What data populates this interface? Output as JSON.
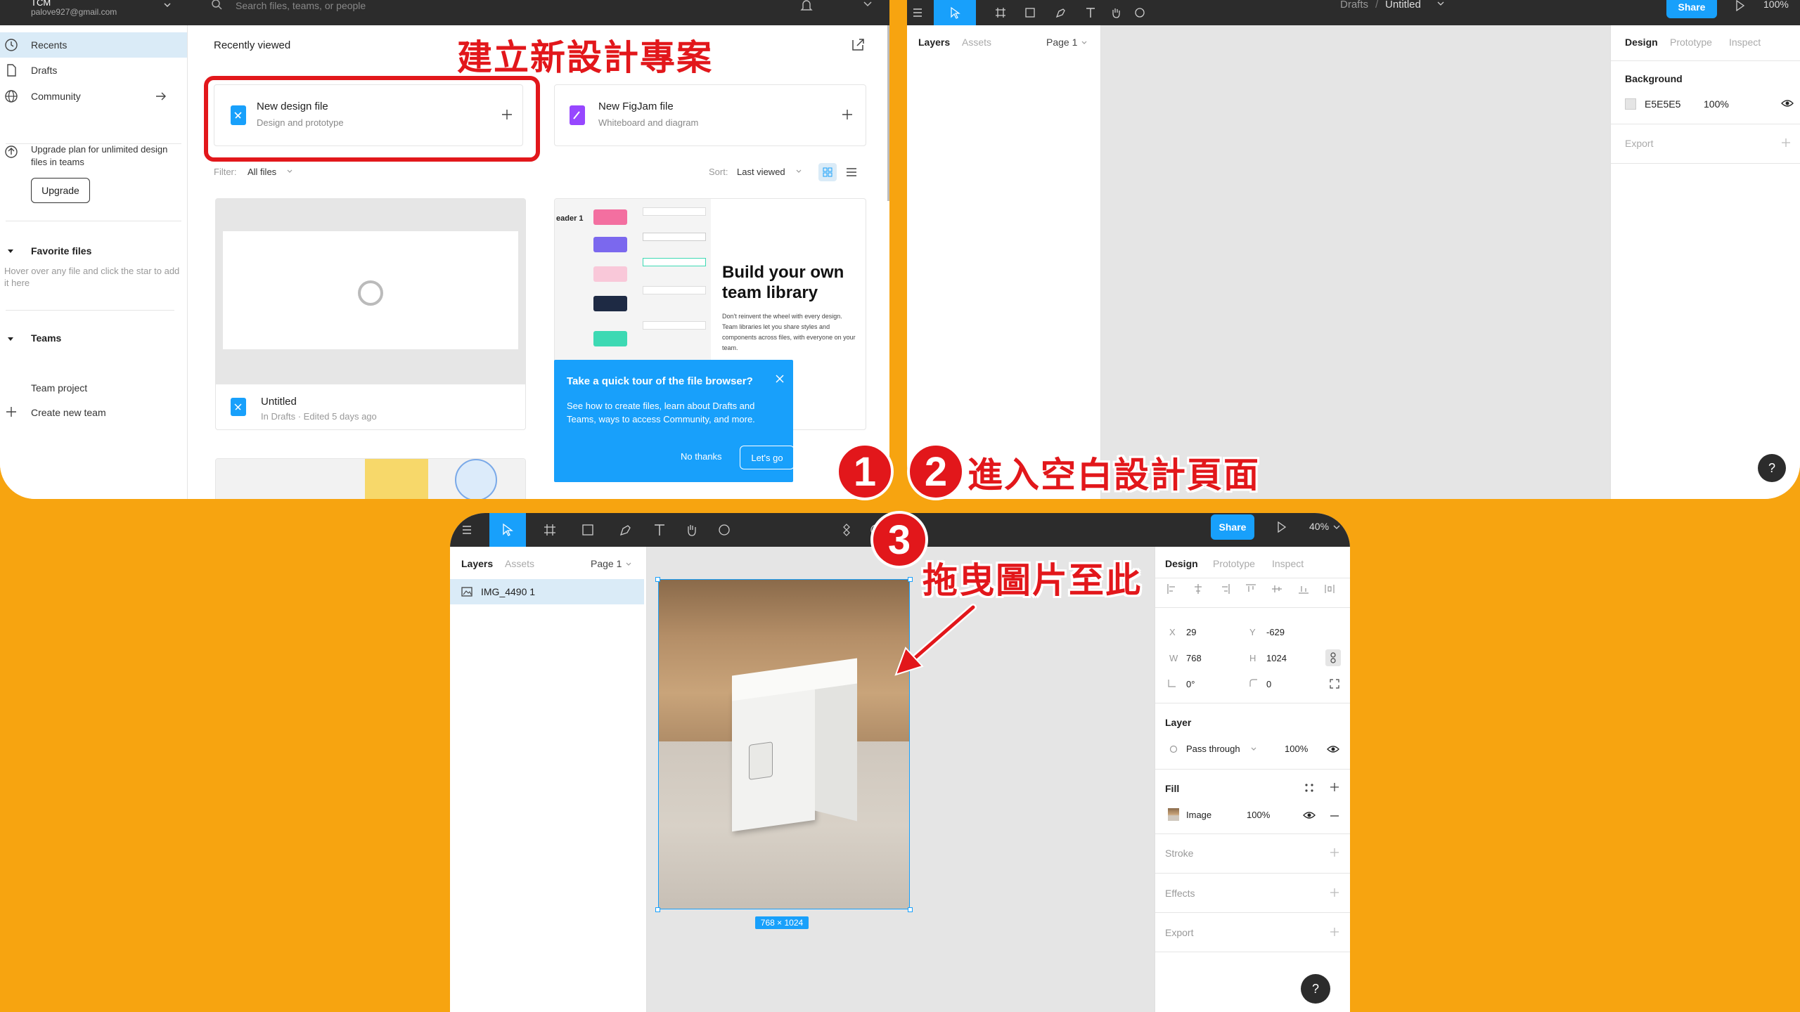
{
  "panel1": {
    "account": {
      "name": "TCM",
      "email": "palove927@gmail.com"
    },
    "search_placeholder": "Search files, teams, or people",
    "sidebar": {
      "recents": "Recents",
      "drafts": "Drafts",
      "community": "Community",
      "upgrade_text": "Upgrade plan for unlimited design files in teams",
      "upgrade_button": "Upgrade",
      "favorites_title": "Favorite files",
      "favorites_hint": "Hover over any file and click the star to add it here",
      "teams_title": "Teams",
      "team_project": "Team project",
      "create_team": "Create new team"
    },
    "main": {
      "heading": "Recently viewed",
      "new_design": {
        "title": "New design file",
        "subtitle": "Design and prototype"
      },
      "new_figjam": {
        "title": "New FigJam file",
        "subtitle": "Whiteboard and diagram"
      },
      "filter_label": "Filter:",
      "filter_value": "All files",
      "sort_label": "Sort:",
      "sort_value": "Last viewed",
      "file": {
        "name": "Untitled",
        "meta": "In Drafts · Edited 5 days ago"
      },
      "promo": {
        "title": "Build your own team library",
        "body": "Don't reinvent the wheel with every design. Team libraries let you share styles and components across files, with everyone on your team."
      },
      "tour": {
        "title": "Take a quick tour of the file browser?",
        "body": "See how to create files, learn about Drafts and Teams, ways to access Community, and more.",
        "no_thanks": "No thanks",
        "lets_go": "Let's go"
      }
    }
  },
  "panel2": {
    "breadcrumb_drafts": "Drafts",
    "breadcrumb_sep": "/",
    "file_title": "Untitled",
    "share": "Share",
    "zoom": "100%",
    "left_tabs": {
      "layers": "Layers",
      "assets": "Assets",
      "page": "Page 1"
    },
    "right_tabs": {
      "design": "Design",
      "prototype": "Prototype",
      "inspect": "Inspect"
    },
    "background_title": "Background",
    "background_hex": "E5E5E5",
    "background_opacity": "100%",
    "export": "Export",
    "help": "?"
  },
  "panel3": {
    "share": "Share",
    "zoom": "40%",
    "left_tabs": {
      "layers": "Layers",
      "assets": "Assets",
      "page": "Page 1"
    },
    "layer_name": "IMG_4490 1",
    "size_badge": "768 × 1024",
    "right_tabs": {
      "design": "Design",
      "prototype": "Prototype",
      "inspect": "Inspect"
    },
    "props": {
      "x_label": "X",
      "x": "29",
      "y_label": "Y",
      "y": "-629",
      "w_label": "W",
      "w": "768",
      "h_label": "H",
      "h": "1024",
      "rotation": "0°",
      "radius": "0"
    },
    "layer_title": "Layer",
    "blend": "Pass through",
    "layer_opacity": "100%",
    "fill_title": "Fill",
    "fill_type": "Image",
    "fill_opacity": "100%",
    "stroke": "Stroke",
    "effects": "Effects",
    "export": "Export",
    "help": "?"
  },
  "annotations": {
    "step1_number": "1",
    "step1_text": "建立新設計專案",
    "step2_number": "2",
    "step2_text": "進入空白設計頁面",
    "step3_number": "3",
    "step3_text": "拖曳圖片至此"
  },
  "colors": {
    "accent": "#18A0FB",
    "highlight_red": "#E2171B",
    "background_orange": "#F7A410",
    "toolbar_dark": "#2C2C2C",
    "canvas": "#E5E5E5"
  }
}
